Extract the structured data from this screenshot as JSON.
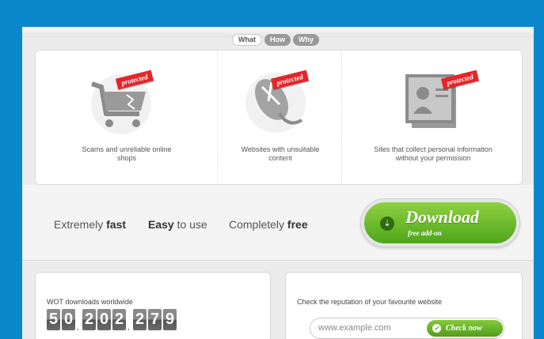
{
  "tabs": [
    "What",
    "How",
    "Why"
  ],
  "protections": [
    {
      "ribbon": "protected",
      "caption": "Scams and unreliable online shops",
      "icon": "shopping-cart-icon"
    },
    {
      "ribbon": "protected",
      "caption": "Websites with unsuitable content",
      "icon": "mouse-icon"
    },
    {
      "ribbon": "protected",
      "caption": "Sites that collect personal information without your permission",
      "icon": "id-card-icon"
    }
  ],
  "features": [
    {
      "normal_before": "Extremely ",
      "bold": "fast",
      "normal_after": ""
    },
    {
      "normal_before": "",
      "bold": "Easy",
      "normal_after": " to use"
    },
    {
      "normal_before": "Completely ",
      "bold": "free",
      "normal_after": ""
    }
  ],
  "download": {
    "title": "Download",
    "subtitle": "free add-on"
  },
  "downloads": {
    "label": "WOT downloads worldwide",
    "digits": [
      "5",
      "0",
      "2",
      "0",
      "2",
      "2",
      "7",
      "9"
    ]
  },
  "reputation": {
    "label": "Check the reputation of your favourite website",
    "placeholder": "www.example.com",
    "button": "Check now"
  },
  "colors": {
    "accent_green": "#5cb82a",
    "ribbon_red": "#e3262a",
    "background_blue": "#0b87cc"
  }
}
